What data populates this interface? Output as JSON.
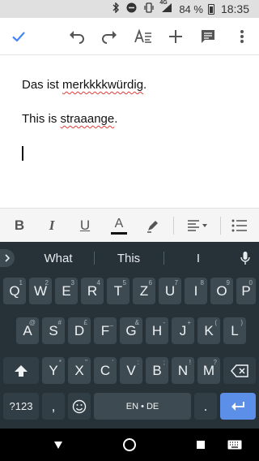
{
  "status": {
    "battery_pct": "84 %",
    "time": "18:35",
    "network": "4G"
  },
  "document": {
    "line1": {
      "prefix": "Das ist ",
      "word": "merkkkkwürdig",
      "suffix": "."
    },
    "line2": {
      "prefix": "This is ",
      "word": "straaange",
      "suffix": "."
    }
  },
  "format": {
    "bold": "B",
    "italic": "I",
    "underline": "U",
    "text_color": "A"
  },
  "suggestions": [
    "What",
    "This",
    "I"
  ],
  "keys": {
    "row1": [
      {
        "l": "Q",
        "h": "1"
      },
      {
        "l": "W",
        "h": "2"
      },
      {
        "l": "E",
        "h": "3"
      },
      {
        "l": "R",
        "h": "4"
      },
      {
        "l": "T",
        "h": "5"
      },
      {
        "l": "Z",
        "h": "6"
      },
      {
        "l": "U",
        "h": "7"
      },
      {
        "l": "I",
        "h": "8"
      },
      {
        "l": "O",
        "h": "9"
      },
      {
        "l": "P",
        "h": "0"
      }
    ],
    "row2": [
      {
        "l": "A",
        "h": "@"
      },
      {
        "l": "S",
        "h": "#"
      },
      {
        "l": "D",
        "h": "£"
      },
      {
        "l": "F",
        "h": "_"
      },
      {
        "l": "G",
        "h": "&"
      },
      {
        "l": "H",
        "h": "-"
      },
      {
        "l": "J",
        "h": "+"
      },
      {
        "l": "K",
        "h": "("
      },
      {
        "l": "L",
        "h": ")"
      }
    ],
    "row3": [
      {
        "l": "Y",
        "h": "*"
      },
      {
        "l": "X",
        "h": "\""
      },
      {
        "l": "C",
        "h": "'"
      },
      {
        "l": "V",
        "h": ":"
      },
      {
        "l": "B",
        "h": ";"
      },
      {
        "l": "N",
        "h": "!"
      },
      {
        "l": "M",
        "h": "?"
      }
    ],
    "symbols": "?123",
    "comma": ",",
    "space": "EN • DE",
    "period": "."
  },
  "colors": {
    "accent": "#4285f4",
    "keyboard_bg": "#263238",
    "key_bg": "#3e4a51",
    "enter_key": "#5b8fe8",
    "spell_underline": "#e53935"
  }
}
